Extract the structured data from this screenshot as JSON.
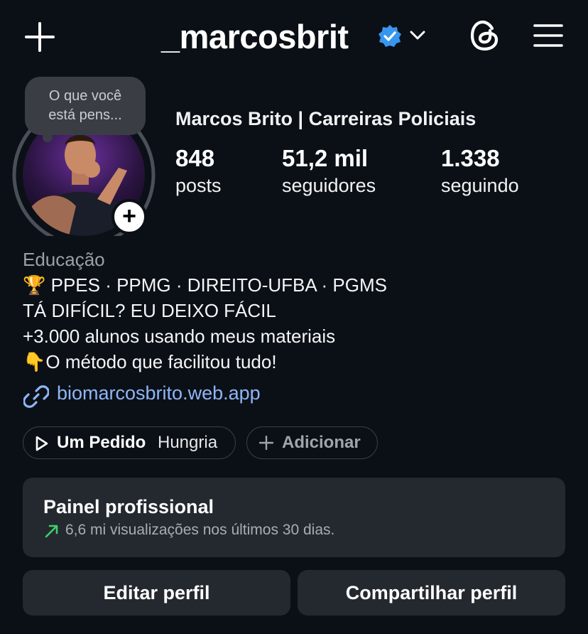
{
  "header": {
    "username": "_marcosbrit",
    "verified": true,
    "icons": [
      "plus-icon",
      "verified-badge-icon",
      "chevron-down-icon",
      "threads-icon",
      "menu-icon"
    ]
  },
  "note": {
    "line1": "O que você",
    "line2": "está pens..."
  },
  "profile": {
    "full_name": "Marcos Brito | Carreiras Policiais",
    "stats": [
      {
        "value": "848",
        "label": "posts"
      },
      {
        "value": "51,2 mil",
        "label": "seguidores"
      },
      {
        "value": "1.338",
        "label": "seguindo"
      }
    ]
  },
  "bio": {
    "category": "Educação",
    "line1_emoji": "🏆",
    "line1_text": "PPES · PPMG · DIREITO-UFBA · PGMS",
    "line2": "TÁ DIFÍCIL? EU DEIXO FÁCIL",
    "line3": "+3.000 alunos usando meus materiais",
    "line4_emoji": "👇",
    "line4_text": "O método que facilitou tudo!",
    "link": "biomarcosbrito.web.app"
  },
  "music": {
    "title": "Um Pedido",
    "artist": "Hungria"
  },
  "add_pill": {
    "label": "Adicionar"
  },
  "dashboard": {
    "title": "Painel profissional",
    "subtitle": "6,6 mi visualizações nos últimos 30 dias."
  },
  "buttons": {
    "edit": "Editar perfil",
    "share": "Compartilhar perfil"
  },
  "colors": {
    "background": "#0b1016",
    "card": "#24292f",
    "link": "#8fb5f7",
    "verified": "#3797f0",
    "trend": "#3ecf6b"
  }
}
